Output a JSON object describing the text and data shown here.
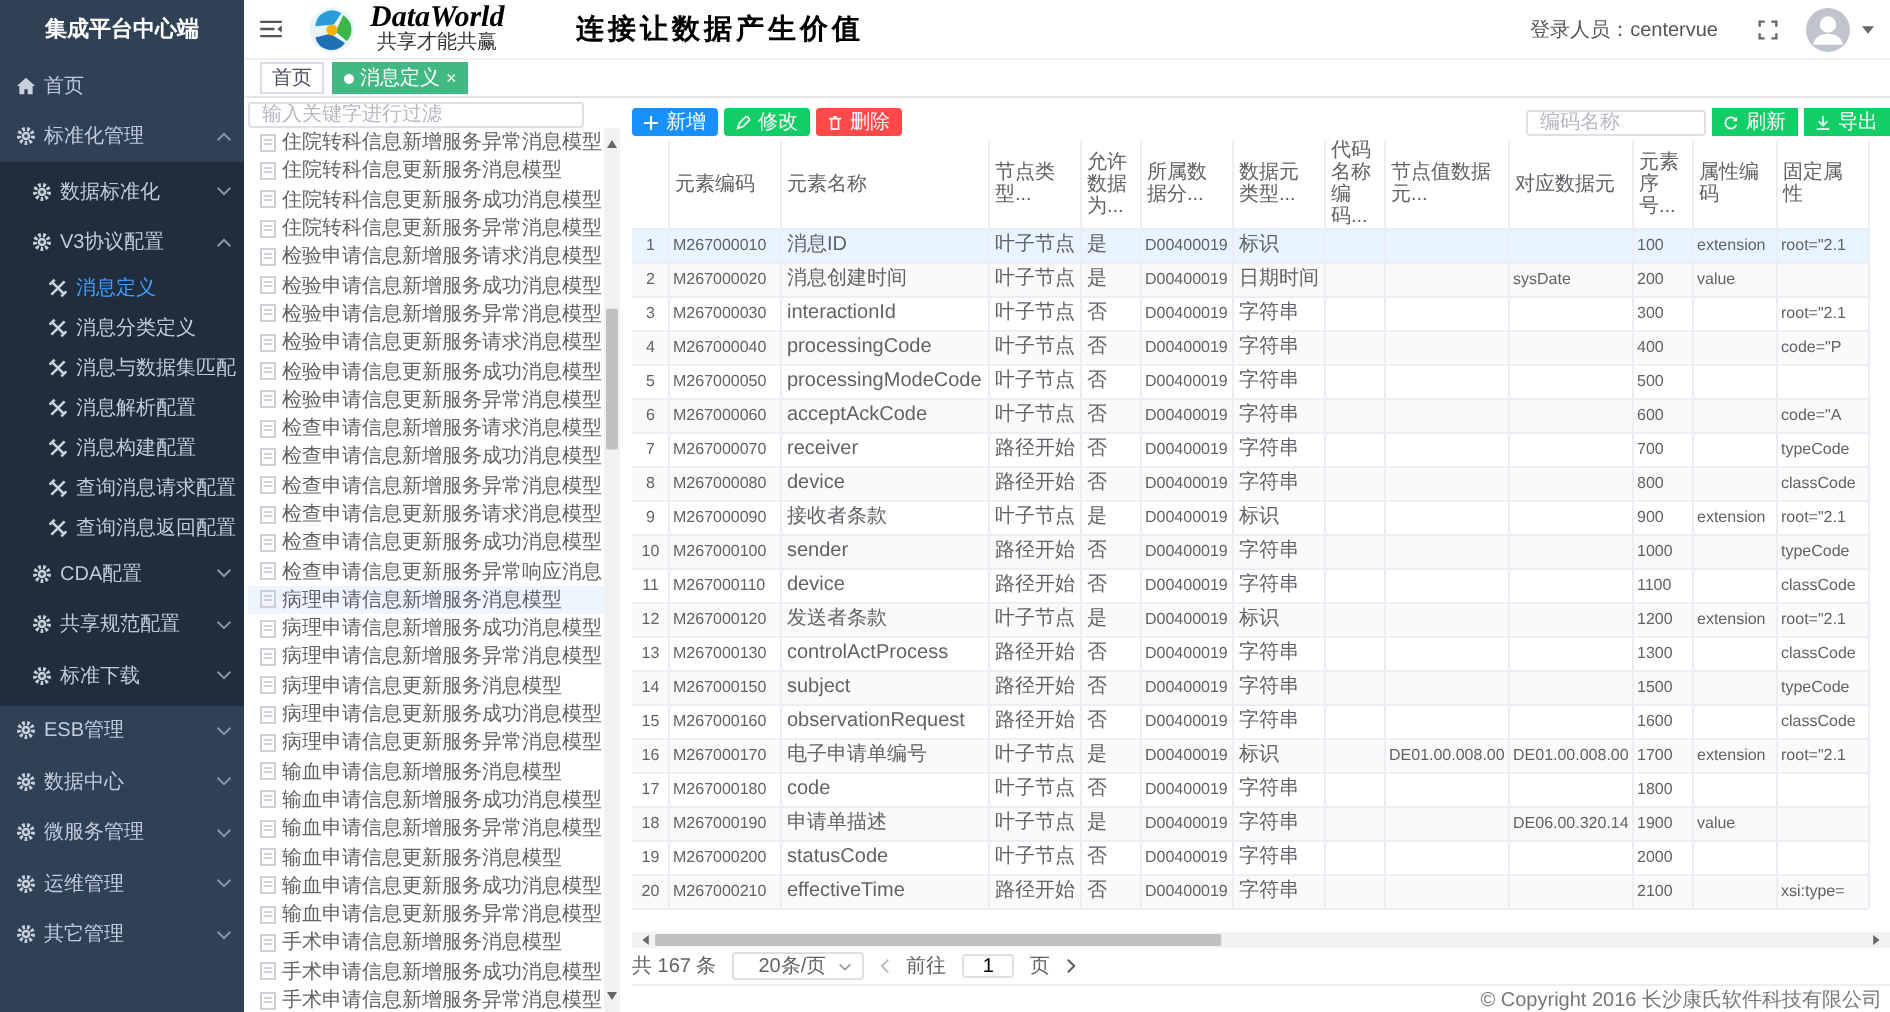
{
  "sidebar": {
    "title": "集成平台中心端",
    "items": [
      {
        "label": "首页",
        "kind": "home"
      },
      {
        "label": "标准化管理",
        "kind": "group",
        "expanded": true,
        "children": [
          {
            "label": "数据标准化",
            "kind": "group",
            "expanded": false
          },
          {
            "label": "V3协议配置",
            "kind": "group",
            "expanded": true,
            "children": [
              {
                "label": "消息定义",
                "kind": "leaf",
                "selected": true
              },
              {
                "label": "消息分类定义",
                "kind": "leaf",
                "selected": false
              },
              {
                "label": "消息与数据集匹配",
                "kind": "leaf",
                "selected": false
              },
              {
                "label": "消息解析配置",
                "kind": "leaf",
                "selected": false
              },
              {
                "label": "消息构建配置",
                "kind": "leaf",
                "selected": false
              },
              {
                "label": "查询消息请求配置",
                "kind": "leaf",
                "selected": false
              },
              {
                "label": "查询消息返回配置",
                "kind": "leaf",
                "selected": false
              }
            ]
          },
          {
            "label": "CDA配置",
            "kind": "group",
            "expanded": false
          },
          {
            "label": "共享规范配置",
            "kind": "group",
            "expanded": false
          },
          {
            "label": "标准下载",
            "kind": "group",
            "expanded": false
          }
        ]
      },
      {
        "label": "ESB管理",
        "kind": "group",
        "expanded": false
      },
      {
        "label": "数据中心",
        "kind": "group",
        "expanded": false
      },
      {
        "label": "微服务管理",
        "kind": "group",
        "expanded": false
      },
      {
        "label": "运维管理",
        "kind": "group",
        "expanded": false
      },
      {
        "label": "其它管理",
        "kind": "group",
        "expanded": false
      }
    ]
  },
  "header": {
    "logo_text": "DataWorld",
    "logo_subtitle": "共享才能共赢",
    "slogan": "连接让数据产生价值",
    "user_label": "登录人员：centervue"
  },
  "tabs": [
    {
      "label": "首页",
      "selected": false
    },
    {
      "label": "消息定义",
      "selected": true,
      "close": "×"
    }
  ],
  "tree": {
    "placeholder": "输入关键字进行过滤",
    "items": [
      {
        "label": "住院转科信息新增服务异常消息模型",
        "selected": false
      },
      {
        "label": "住院转科信息更新服务消息模型",
        "selected": false
      },
      {
        "label": "住院转科信息更新服务成功消息模型",
        "selected": false
      },
      {
        "label": "住院转科信息更新服务异常消息模型",
        "selected": false
      },
      {
        "label": "检验申请信息新增服务请求消息模型",
        "selected": false
      },
      {
        "label": "检验申请信息新增服务成功消息模型",
        "selected": false
      },
      {
        "label": "检验申请信息新增服务异常消息模型",
        "selected": false
      },
      {
        "label": "检验申请信息更新服务请求消息模型",
        "selected": false
      },
      {
        "label": "检验申请信息更新服务成功消息模型",
        "selected": false
      },
      {
        "label": "检验申请信息更新服务异常消息模型",
        "selected": false
      },
      {
        "label": "检查申请信息新增服务请求消息模型",
        "selected": false
      },
      {
        "label": "检查申请信息新增服务成功消息模型",
        "selected": false
      },
      {
        "label": "检查申请信息新增服务异常消息模型",
        "selected": false
      },
      {
        "label": "检查申请信息更新服务请求消息模型",
        "selected": false
      },
      {
        "label": "检查申请信息更新服务成功消息模型",
        "selected": false
      },
      {
        "label": "检查申请信息更新服务异常响应消息",
        "selected": false
      },
      {
        "label": "病理申请信息新增服务消息模型",
        "selected": true
      },
      {
        "label": "病理申请信息新增服务成功消息模型",
        "selected": false
      },
      {
        "label": "病理申请信息新增服务异常消息模型",
        "selected": false
      },
      {
        "label": "病理申请信息更新服务消息模型",
        "selected": false
      },
      {
        "label": "病理申请信息更新服务成功消息模型",
        "selected": false
      },
      {
        "label": "病理申请信息更新服务异常消息模型",
        "selected": false
      },
      {
        "label": "输血申请信息新增服务消息模型",
        "selected": false
      },
      {
        "label": "输血申请信息新增服务成功消息模型",
        "selected": false
      },
      {
        "label": "输血申请信息新增服务异常消息模型",
        "selected": false
      },
      {
        "label": "输血申请信息更新服务消息模型",
        "selected": false
      },
      {
        "label": "输血申请信息更新服务成功消息模型",
        "selected": false
      },
      {
        "label": "输血申请信息更新服务异常消息模型",
        "selected": false
      },
      {
        "label": "手术申请信息新增服务消息模型",
        "selected": false
      },
      {
        "label": "手术申请信息新增服务成功消息模型",
        "selected": false
      },
      {
        "label": "手术申请信息新增服务异常消息模型",
        "selected": false
      }
    ]
  },
  "toolbar": {
    "buttons": [
      {
        "label": "新增",
        "kind": "add"
      },
      {
        "label": "修改",
        "kind": "edit"
      },
      {
        "label": "删除",
        "kind": "delete"
      }
    ],
    "search_placeholder": "编码名称",
    "actions": [
      {
        "label": "刷新",
        "kind": "refresh"
      },
      {
        "label": "导出",
        "kind": "export"
      }
    ]
  },
  "table": {
    "columns": [
      {
        "label": "元素编码",
        "kind": "code"
      },
      {
        "label": "元素名称",
        "kind": "text"
      },
      {
        "label": "节点类型...",
        "kind": "text"
      },
      {
        "label": "允许数据为...",
        "kind": "text"
      },
      {
        "label": "所属数据分...",
        "kind": "code"
      },
      {
        "label": "数据元类型...",
        "kind": "text"
      },
      {
        "label": "代码名称编码..."
      },
      {
        "label": "节点值数据元...",
        "kind": "code"
      },
      {
        "label": "对应数据元",
        "kind": "code"
      },
      {
        "label": "元素序号...",
        "kind": "code"
      },
      {
        "label": "属性编码",
        "kind": "code"
      },
      {
        "label": "固定属性",
        "kind": "code"
      }
    ],
    "rows": [
      {
        "number": "1",
        "selected": true,
        "cells": [
          "M267000010",
          "消息ID",
          "叶子节点",
          "是",
          "D00400019",
          "标识",
          "",
          "",
          "",
          "100",
          "extension",
          "root=\"2.1"
        ]
      },
      {
        "number": "2",
        "selected": false,
        "cells": [
          "M267000020",
          "消息创建时间",
          "叶子节点",
          "是",
          "D00400019",
          "日期时间",
          "",
          "",
          "sysDate",
          "200",
          "value",
          ""
        ]
      },
      {
        "number": "3",
        "selected": false,
        "cells": [
          "M267000030",
          "interactionId",
          "叶子节点",
          "否",
          "D00400019",
          "字符串",
          "",
          "",
          "",
          "300",
          "",
          "root=\"2.1"
        ]
      },
      {
        "number": "4",
        "selected": false,
        "cells": [
          "M267000040",
          "processingCode",
          "叶子节点",
          "否",
          "D00400019",
          "字符串",
          "",
          "",
          "",
          "400",
          "",
          "code=\"P"
        ]
      },
      {
        "number": "5",
        "selected": false,
        "cells": [
          "M267000050",
          "processingModeCode",
          "叶子节点",
          "否",
          "D00400019",
          "字符串",
          "",
          "",
          "",
          "500",
          "",
          ""
        ]
      },
      {
        "number": "6",
        "selected": false,
        "cells": [
          "M267000060",
          "acceptAckCode",
          "叶子节点",
          "否",
          "D00400019",
          "字符串",
          "",
          "",
          "",
          "600",
          "",
          "code=\"A"
        ]
      },
      {
        "number": "7",
        "selected": false,
        "cells": [
          "M267000070",
          "receiver",
          "路径开始",
          "否",
          "D00400019",
          "字符串",
          "",
          "",
          "",
          "700",
          "",
          "typeCode"
        ]
      },
      {
        "number": "8",
        "selected": false,
        "cells": [
          "M267000080",
          "device",
          "路径开始",
          "否",
          "D00400019",
          "字符串",
          "",
          "",
          "",
          "800",
          "",
          "classCode"
        ]
      },
      {
        "number": "9",
        "selected": false,
        "cells": [
          "M267000090",
          "接收者条款",
          "叶子节点",
          "是",
          "D00400019",
          "标识",
          "",
          "",
          "",
          "900",
          "extension",
          "root=\"2.1"
        ]
      },
      {
        "number": "10",
        "selected": false,
        "cells": [
          "M267000100",
          "sender",
          "路径开始",
          "否",
          "D00400019",
          "字符串",
          "",
          "",
          "",
          "1000",
          "",
          "typeCode"
        ]
      },
      {
        "number": "11",
        "selected": false,
        "cells": [
          "M267000110",
          "device",
          "路径开始",
          "否",
          "D00400019",
          "字符串",
          "",
          "",
          "",
          "1100",
          "",
          "classCode"
        ]
      },
      {
        "number": "12",
        "selected": false,
        "cells": [
          "M267000120",
          "发送者条款",
          "叶子节点",
          "是",
          "D00400019",
          "标识",
          "",
          "",
          "",
          "1200",
          "extension",
          "root=\"2.1"
        ]
      },
      {
        "number": "13",
        "selected": false,
        "cells": [
          "M267000130",
          "controlActProcess",
          "路径开始",
          "否",
          "D00400019",
          "字符串",
          "",
          "",
          "",
          "1300",
          "",
          "classCode"
        ]
      },
      {
        "number": "14",
        "selected": false,
        "cells": [
          "M267000150",
          "subject",
          "路径开始",
          "否",
          "D00400019",
          "字符串",
          "",
          "",
          "",
          "1500",
          "",
          "typeCode"
        ]
      },
      {
        "number": "15",
        "selected": false,
        "cells": [
          "M267000160",
          "observationRequest",
          "路径开始",
          "否",
          "D00400019",
          "字符串",
          "",
          "",
          "",
          "1600",
          "",
          "classCode"
        ]
      },
      {
        "number": "16",
        "selected": false,
        "cells": [
          "M267000170",
          "电子申请单编号",
          "叶子节点",
          "是",
          "D00400019",
          "标识",
          "",
          "DE01.00.008.00",
          "DE01.00.008.00",
          "1700",
          "extension",
          "root=\"2.1"
        ]
      },
      {
        "number": "17",
        "selected": false,
        "cells": [
          "M267000180",
          "code",
          "叶子节点",
          "否",
          "D00400019",
          "字符串",
          "",
          "",
          "",
          "1800",
          "",
          ""
        ]
      },
      {
        "number": "18",
        "selected": false,
        "cells": [
          "M267000190",
          "申请单描述",
          "叶子节点",
          "是",
          "D00400019",
          "字符串",
          "",
          "",
          "DE06.00.320.14",
          "1900",
          "value",
          ""
        ]
      },
      {
        "number": "19",
        "selected": false,
        "cells": [
          "M267000200",
          "statusCode",
          "叶子节点",
          "否",
          "D00400019",
          "字符串",
          "",
          "",
          "",
          "2000",
          "",
          ""
        ]
      },
      {
        "number": "20",
        "selected": false,
        "cells": [
          "M267000210",
          "effectiveTime",
          "路径开始",
          "否",
          "D00400019",
          "字符串",
          "",
          "",
          "",
          "2100",
          "",
          "xsi:type="
        ]
      }
    ]
  },
  "pagination": {
    "total": "共 167 条",
    "page_size": "20条/页",
    "goto_label": "前往",
    "page": "1",
    "page_unit": "页"
  },
  "footer": "© Copyright 2016 长沙康氏软件科技有限公司"
}
